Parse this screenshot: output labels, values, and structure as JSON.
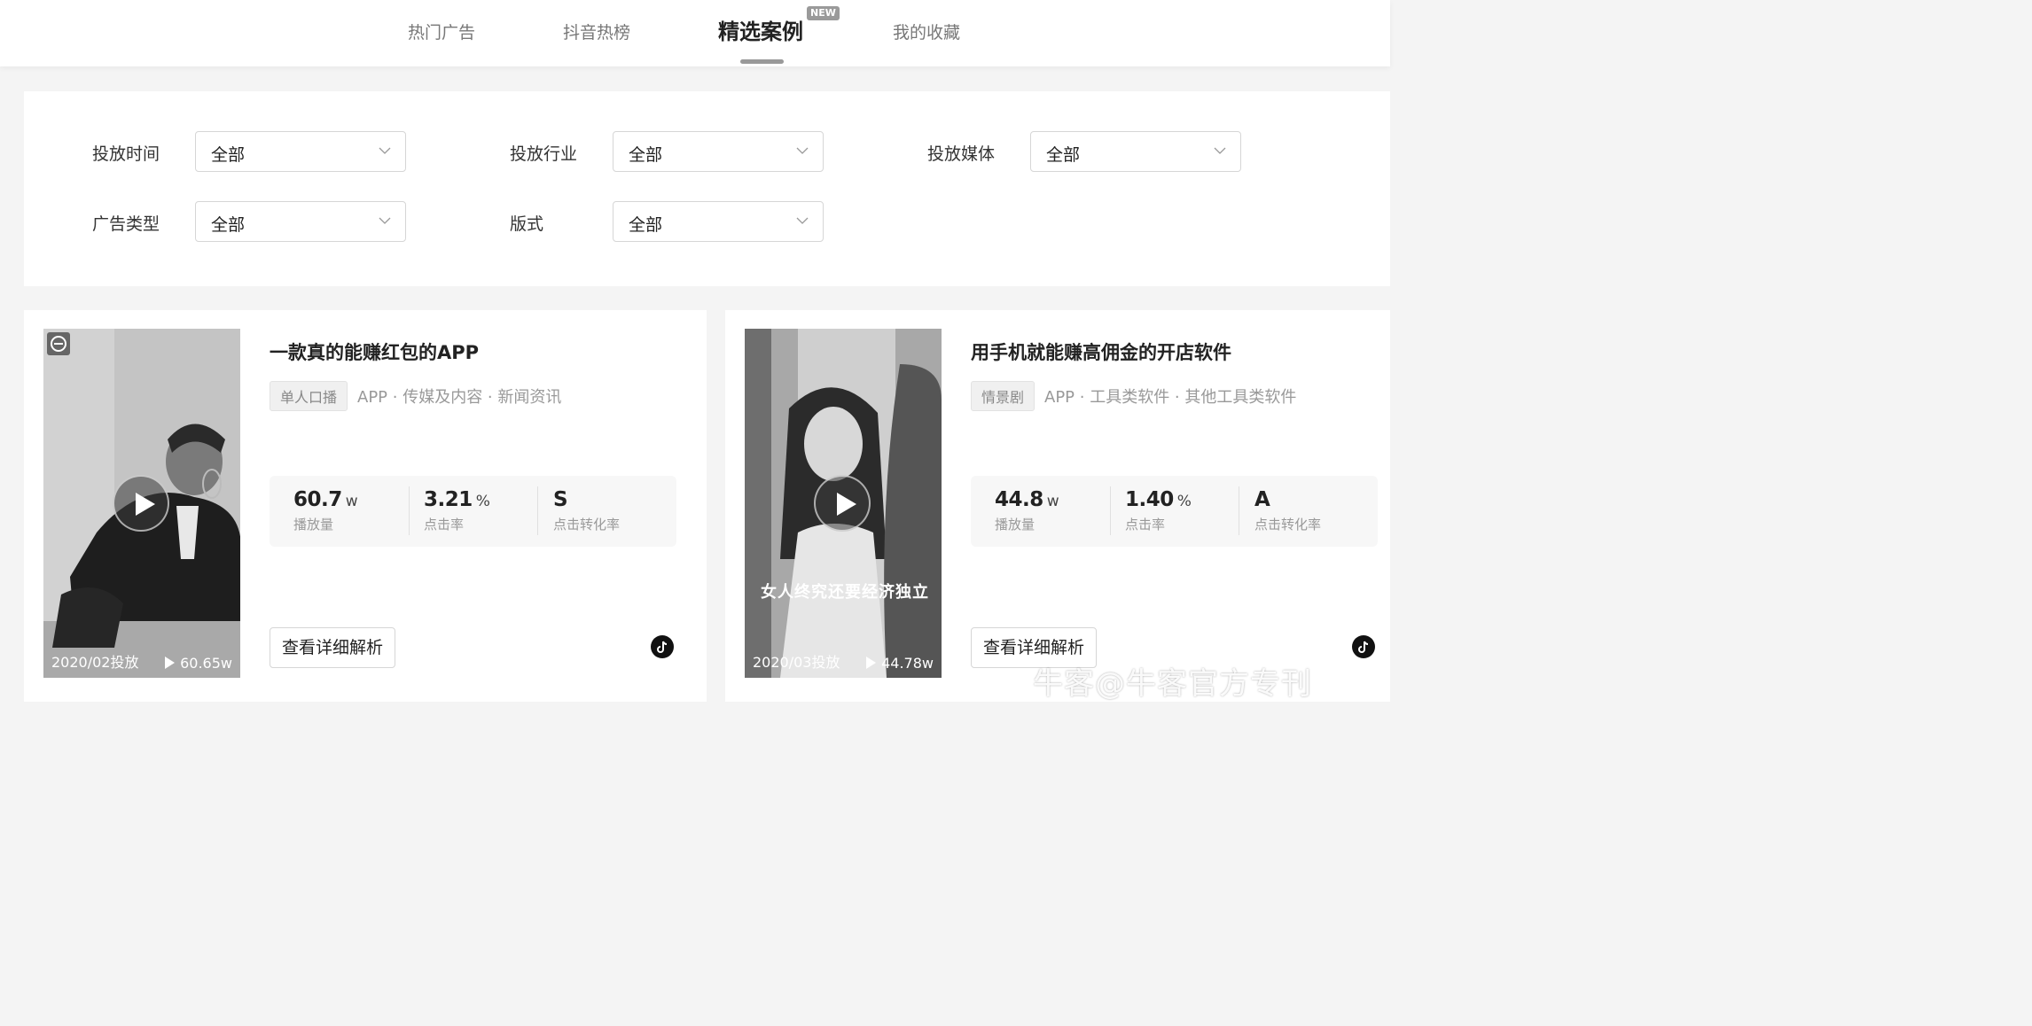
{
  "nav": {
    "tabs": [
      {
        "label": "热门广告"
      },
      {
        "label": "抖音热榜"
      },
      {
        "label": "精选案例",
        "badge": "NEW",
        "active": true
      },
      {
        "label": "我的收藏"
      }
    ]
  },
  "filters": {
    "time": {
      "label": "投放时间",
      "value": "全部"
    },
    "industry": {
      "label": "投放行业",
      "value": "全部"
    },
    "media": {
      "label": "投放媒体",
      "value": "全部"
    },
    "ad_type": {
      "label": "广告类型",
      "value": "全部"
    },
    "format": {
      "label": "版式",
      "value": "全部"
    }
  },
  "cases": [
    {
      "title": "一款真的能赚红包的APP",
      "tag": "单人口播",
      "categories": "APP · 传媒及内容 · 新闻资讯",
      "date": "2020/02投放",
      "views": "60.65w",
      "stats": {
        "plays": {
          "value": "60.7",
          "unit": "w",
          "label": "播放量"
        },
        "ctr": {
          "value": "3.21",
          "unit": "%",
          "label": "点击率"
        },
        "cvr": {
          "value": "S",
          "unit": "",
          "label": "点击转化率"
        }
      },
      "button": "查看详细解析",
      "subtitle": ""
    },
    {
      "title": "用手机就能赚高佣金的开店软件",
      "tag": "情景剧",
      "categories": "APP · 工具类软件 · 其他工具类软件",
      "date": "2020/03投放",
      "views": "44.78w",
      "stats": {
        "plays": {
          "value": "44.8",
          "unit": "w",
          "label": "播放量"
        },
        "ctr": {
          "value": "1.40",
          "unit": "%",
          "label": "点击率"
        },
        "cvr": {
          "value": "A",
          "unit": "",
          "label": "点击转化率"
        }
      },
      "button": "查看详细解析",
      "subtitle": "女人终究还要经济独立"
    }
  ],
  "watermark": "牛客@牛客官方专刊",
  "icons": {
    "dropdown": "chevron-down-icon",
    "play": "play-icon",
    "platform": "tiktok-icon",
    "brand": "brand-logo-icon"
  }
}
